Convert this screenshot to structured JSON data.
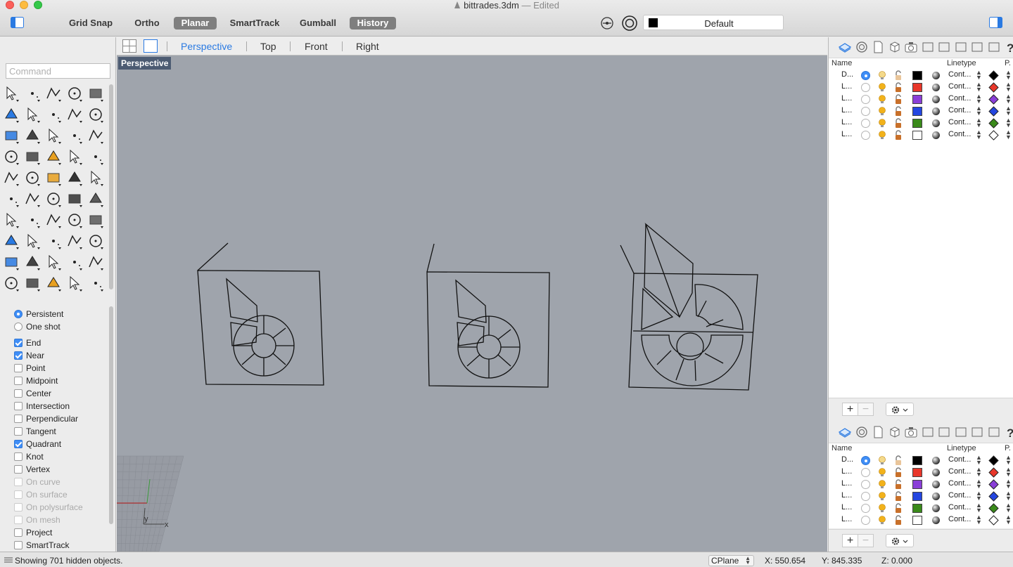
{
  "window": {
    "title": "bittrades.3dm",
    "edited_label": "— Edited"
  },
  "toolbar": {
    "buttons": [
      {
        "label": "Grid Snap",
        "active": false
      },
      {
        "label": "Ortho",
        "active": false
      },
      {
        "label": "Planar",
        "active": true
      },
      {
        "label": "SmartTrack",
        "active": false
      },
      {
        "label": "Gumball",
        "active": false
      },
      {
        "label": "History",
        "active": true
      }
    ],
    "current_layer": "Default",
    "current_layer_color": "#000000"
  },
  "left_panel": {
    "command_placeholder": "Command",
    "osnap_mode": [
      {
        "label": "Persistent",
        "selected": true
      },
      {
        "label": "One shot",
        "selected": false
      }
    ],
    "osnaps": [
      {
        "label": "End",
        "checked": true,
        "enabled": true
      },
      {
        "label": "Near",
        "checked": true,
        "enabled": true
      },
      {
        "label": "Point",
        "checked": false,
        "enabled": true
      },
      {
        "label": "Midpoint",
        "checked": false,
        "enabled": true
      },
      {
        "label": "Center",
        "checked": false,
        "enabled": true
      },
      {
        "label": "Intersection",
        "checked": false,
        "enabled": true
      },
      {
        "label": "Perpendicular",
        "checked": false,
        "enabled": true
      },
      {
        "label": "Tangent",
        "checked": false,
        "enabled": true
      },
      {
        "label": "Quadrant",
        "checked": true,
        "enabled": true
      },
      {
        "label": "Knot",
        "checked": false,
        "enabled": true
      },
      {
        "label": "Vertex",
        "checked": false,
        "enabled": true
      },
      {
        "label": "On curve",
        "checked": false,
        "enabled": false
      },
      {
        "label": "On surface",
        "checked": false,
        "enabled": false
      },
      {
        "label": "On polysurface",
        "checked": false,
        "enabled": false
      },
      {
        "label": "On mesh",
        "checked": false,
        "enabled": false
      },
      {
        "label": "Project",
        "checked": false,
        "enabled": true
      },
      {
        "label": "SmartTrack",
        "checked": false,
        "enabled": true
      }
    ]
  },
  "viewports": {
    "tabs": [
      {
        "label": "Perspective",
        "active": true
      },
      {
        "label": "Top",
        "active": false
      },
      {
        "label": "Front",
        "active": false
      },
      {
        "label": "Right",
        "active": false
      }
    ],
    "active_label": "Perspective",
    "axis_labels": {
      "x": "x",
      "y": "y"
    }
  },
  "layers_panel": {
    "col_name": "Name",
    "col_linetype": "Linetype",
    "col_print": "P.",
    "add_label": "+",
    "remove_label": "−",
    "rows": [
      {
        "name": "D...",
        "current": true,
        "color": "#000000",
        "linetype": "Cont...",
        "print_color": "#000000"
      },
      {
        "name": "L...",
        "current": false,
        "color": "#e8372a",
        "linetype": "Cont...",
        "print_color": "#e8372a"
      },
      {
        "name": "L...",
        "current": false,
        "color": "#8a3fd8",
        "linetype": "Cont...",
        "print_color": "#8a3fd8"
      },
      {
        "name": "L...",
        "current": false,
        "color": "#2446e0",
        "linetype": "Cont...",
        "print_color": "#2446e0"
      },
      {
        "name": "L...",
        "current": false,
        "color": "#3a8a1a",
        "linetype": "Cont...",
        "print_color": "#3a8a1a"
      },
      {
        "name": "L...",
        "current": false,
        "color": "#ffffff",
        "linetype": "Cont...",
        "print_color": "#ffffff"
      }
    ]
  },
  "statusbar": {
    "message": "Showing 701 hidden objects.",
    "cplane": "CPlane",
    "x": "X: 550.654",
    "y": "Y: 845.335",
    "z": "Z: 0.000"
  }
}
